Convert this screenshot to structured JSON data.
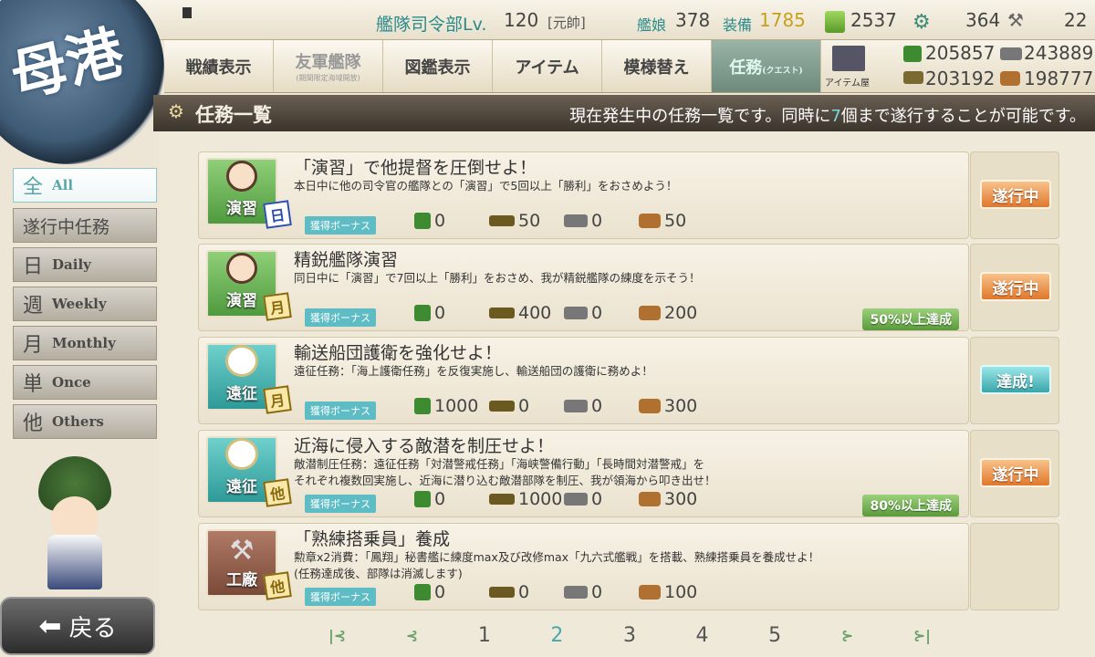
{
  "header": {
    "hq_label": "艦隊司令部Lv.",
    "hq_level": "120",
    "rank": "[元帥]",
    "ships_label": "艦娘",
    "ships": "378",
    "equip_label": "装備",
    "equip": "1785",
    "bucket": "2537",
    "devmat": "364",
    "screw": "22"
  },
  "port_badge": "母港",
  "nav": {
    "items": [
      {
        "label": "戦績表示",
        "sub": ""
      },
      {
        "label": "友軍艦隊",
        "sub": "(期間限定海域開放)"
      },
      {
        "label": "図鑑表示",
        "sub": ""
      },
      {
        "label": "アイテム",
        "sub": ""
      },
      {
        "label": "模様替え",
        "sub": ""
      },
      {
        "label": "任務",
        "sub": "(クエスト)"
      }
    ],
    "shop": "アイテム屋"
  },
  "resources": {
    "fuel": "205857",
    "steel": "243889",
    "ammo": "203192",
    "bauxite": "198777"
  },
  "title": {
    "heading": "任務一覧",
    "message_pre": "現在発生中の任務一覧です。同時に",
    "message_num": "7",
    "message_post": "個まで遂行することが可能です。"
  },
  "tabs": [
    {
      "kanji": "全",
      "en": "All"
    },
    {
      "kanji": "遂行中任務",
      "en": ""
    },
    {
      "kanji": "日",
      "en": "Daily"
    },
    {
      "kanji": "週",
      "en": "Weekly"
    },
    {
      "kanji": "月",
      "en": "Monthly"
    },
    {
      "kanji": "単",
      "en": "Once"
    },
    {
      "kanji": "他",
      "en": "Others"
    }
  ],
  "bonus_label": "獲得ボーナス",
  "quests": [
    {
      "title": "「演習」で他提督を圧倒せよ！",
      "desc": "本日中に他の司令官の艦隊との「演習」で5回以上「勝利」をおさめよう！",
      "category": "演習",
      "freq": "日",
      "fuel": "0",
      "ammo": "50",
      "steel": "0",
      "bauxite": "50",
      "status": "遂行中",
      "progress": ""
    },
    {
      "title": "精鋭艦隊演習",
      "desc": "同日中に「演習」で7回以上「勝利」をおさめ、我が精鋭艦隊の練度を示そう！",
      "category": "演習",
      "freq": "月",
      "fuel": "0",
      "ammo": "400",
      "steel": "0",
      "bauxite": "200",
      "status": "遂行中",
      "progress": "50%以上達成"
    },
    {
      "title": "輸送船団護衛を強化せよ！",
      "desc": "遠征任務：「海上護衛任務」を反復実施し、輸送船団の護衛に務めよ！",
      "category": "遠征",
      "freq": "月",
      "fuel": "1000",
      "ammo": "0",
      "steel": "0",
      "bauxite": "300",
      "status": "達成!",
      "progress": ""
    },
    {
      "title": "近海に侵入する敵潜を制圧せよ！",
      "desc": "敵潜制圧任務：遠征任務「対潜警戒任務」「海峡警備行動」「長時間対潜警戒」を",
      "desc2": "それぞれ複数回実施し、近海に潜り込む敵潜部隊を制圧、我が領海から叩き出せ！",
      "category": "遠征",
      "freq": "他",
      "fuel": "0",
      "ammo": "1000",
      "steel": "0",
      "bauxite": "300",
      "status": "遂行中",
      "progress": "80%以上達成"
    },
    {
      "title": "「熟練搭乗員」養成",
      "desc": "勲章x2消費：「鳳翔」秘書艦に練度max及び改修max「九六式艦戦」を搭載、熟練搭乗員を養成せよ！",
      "desc2": "(任務達成後、部隊は消滅します)",
      "category": "工廠",
      "freq": "他",
      "fuel": "0",
      "ammo": "0",
      "steel": "0",
      "bauxite": "100",
      "status": "",
      "progress": ""
    }
  ],
  "pages": [
    "1",
    "2",
    "3",
    "4",
    "5"
  ],
  "current_page": "2",
  "back_label": "戻る",
  "colors": {
    "accent": "#4aa8aa",
    "orange": "#e0782c",
    "green": "#5b9a3c"
  }
}
